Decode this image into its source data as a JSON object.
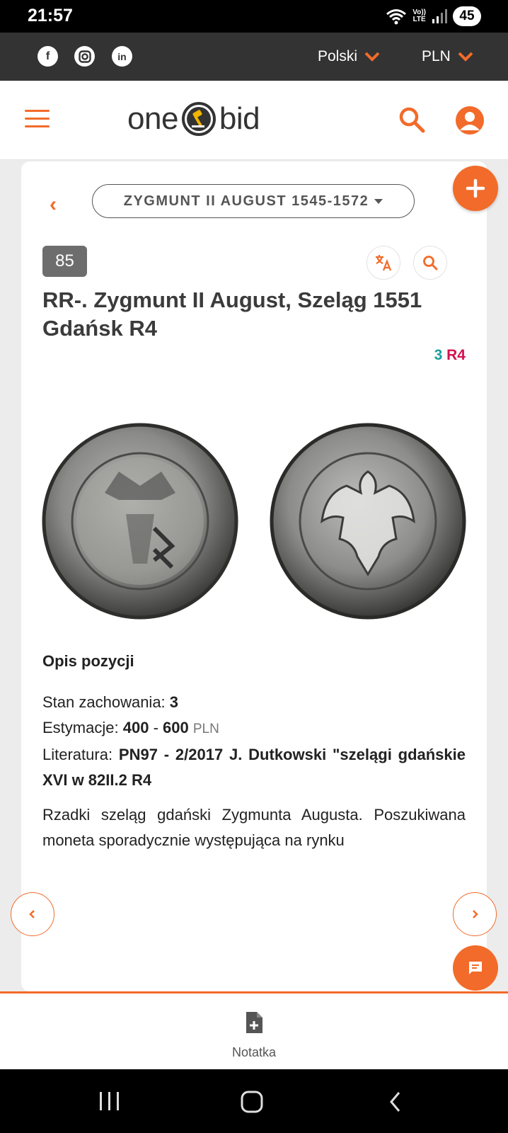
{
  "status_bar": {
    "time": "21:57",
    "volte_line1": "Vo))",
    "volte_line2": "LTE",
    "battery": "45"
  },
  "top_bar": {
    "social_icons": [
      "facebook-icon",
      "instagram-icon",
      "linkedin-icon"
    ],
    "language": "Polski",
    "currency": "PLN"
  },
  "header": {
    "logo_left": "one",
    "logo_right": "bid"
  },
  "category": {
    "label": "ZYGMUNT II AUGUST 1545-1572"
  },
  "lot": {
    "number": "85",
    "title": "RR-. Zygmunt II August, Szeląg 1551 Gdańsk R4",
    "grade_value": "3",
    "grade_rarity": "R4"
  },
  "description": {
    "section_title": "Opis pozycji",
    "condition_label": "Stan zachowania:",
    "condition_value": "3",
    "estimate_label": "Estymacje:",
    "estimate_low": "400",
    "estimate_sep": "-",
    "estimate_high": "600",
    "estimate_currency": "PLN",
    "literature_label": "Literatura:",
    "literature_value": "PN97 - 2/2017 J. Dutkowski \"szelągi gdańskie XVI w 82II.2 R4",
    "remark": "Rzadki szeląg gdański Zygmunta Augusta. Poszukiwana moneta sporadycznie występująca na rynku"
  },
  "bottom_bar": {
    "note_label": "Notatka"
  },
  "colors": {
    "accent": "#f26b2a",
    "dark_bar": "#333333",
    "grade_green": "#1a9e9e",
    "grade_red": "#d4124e"
  }
}
